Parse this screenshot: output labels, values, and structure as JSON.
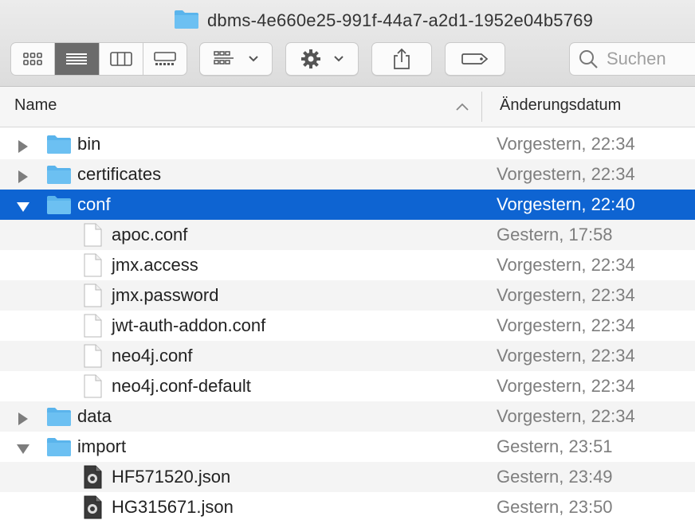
{
  "window": {
    "title": "dbms-4e660e25-991f-44a7-a2d1-1952e04b5769"
  },
  "toolbar": {
    "view_modes": [
      "icon-view",
      "list-view",
      "column-view",
      "gallery-view"
    ],
    "active_view": "list-view",
    "search_placeholder": "Suchen"
  },
  "columns": {
    "name": "Name",
    "date": "Änderungsdatum"
  },
  "rows": [
    {
      "name": "bin",
      "date": "Vorgestern, 22:34",
      "type": "folder",
      "level": 0,
      "disclosure": "collapsed"
    },
    {
      "name": "certificates",
      "date": "Vorgestern, 22:34",
      "type": "folder",
      "level": 0,
      "disclosure": "collapsed"
    },
    {
      "name": "conf",
      "date": "Vorgestern, 22:40",
      "type": "folder",
      "level": 0,
      "disclosure": "expanded",
      "selected": true
    },
    {
      "name": "apoc.conf",
      "date": "Gestern, 17:58",
      "type": "file",
      "level": 1
    },
    {
      "name": "jmx.access",
      "date": "Vorgestern, 22:34",
      "type": "file",
      "level": 1
    },
    {
      "name": "jmx.password",
      "date": "Vorgestern, 22:34",
      "type": "file",
      "level": 1
    },
    {
      "name": "jwt-auth-addon.conf",
      "date": "Vorgestern, 22:34",
      "type": "file",
      "level": 1
    },
    {
      "name": "neo4j.conf",
      "date": "Vorgestern, 22:34",
      "type": "file",
      "level": 1
    },
    {
      "name": "neo4j.conf-default",
      "date": "Vorgestern, 22:34",
      "type": "file",
      "level": 1
    },
    {
      "name": "data",
      "date": "Vorgestern, 22:34",
      "type": "folder",
      "level": 0,
      "disclosure": "collapsed"
    },
    {
      "name": "import",
      "date": "Gestern, 23:51",
      "type": "folder",
      "level": 0,
      "disclosure": "expanded"
    },
    {
      "name": "HF571520.json",
      "date": "Gestern, 23:49",
      "type": "json",
      "level": 1
    },
    {
      "name": "HG315671.json",
      "date": "Gestern, 23:50",
      "type": "json",
      "level": 1
    }
  ],
  "colors": {
    "selection": "#0e64d2",
    "folder": "#5ab4ec",
    "date_text": "#7e7e7e"
  }
}
